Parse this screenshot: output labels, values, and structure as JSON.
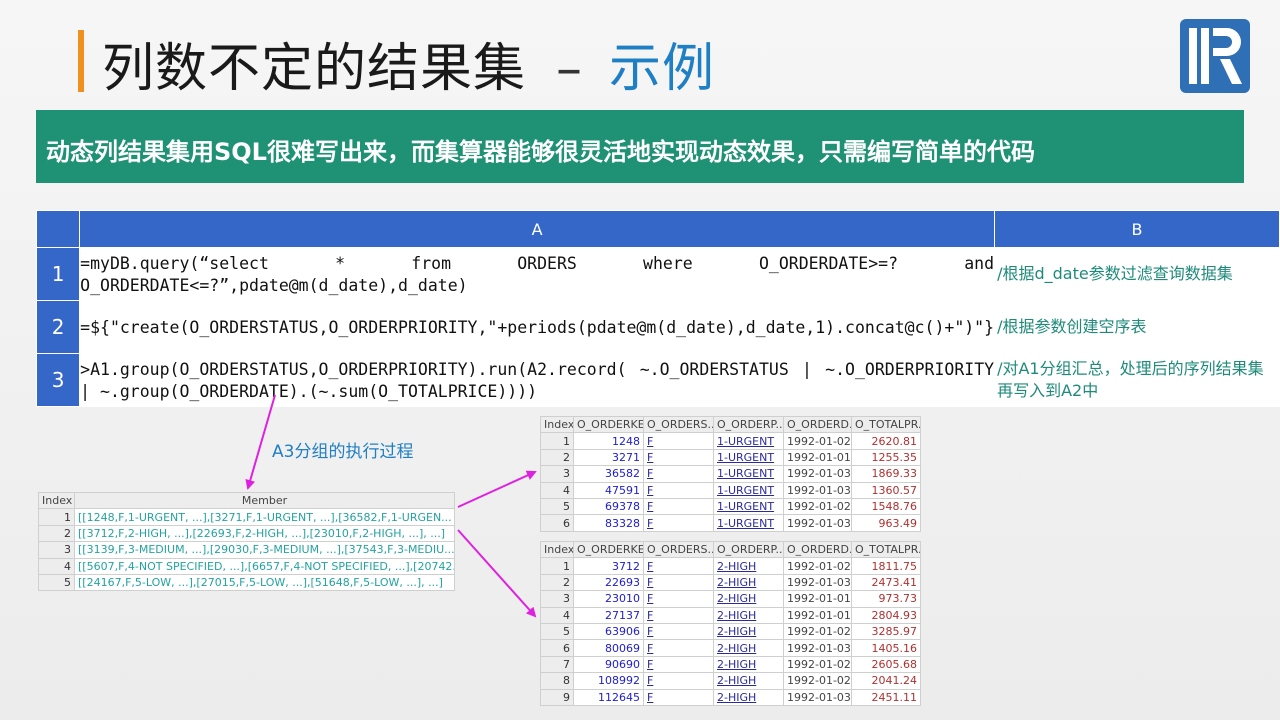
{
  "title": {
    "main": "列数不定的结果集",
    "sep": "–",
    "accent": "示例"
  },
  "banner": "动态列结果集用SQL很难写出来，而集算器能够很灵活地实现动态效果，只需编写简单的代码",
  "grid": {
    "headers": [
      "A",
      "B"
    ],
    "rows": [
      {
        "num": "1",
        "code": "=myDB.query(“select * from ORDERS where O_ORDERDATE>=? and O_ORDERDATE<=?”,pdate@m(d_date),d_date)",
        "comment": "/根据d_date参数过滤查询数据集"
      },
      {
        "num": "2",
        "code": "=${\"create(O_ORDERSTATUS,O_ORDERPRIORITY,\"+periods(pdate@m(d_date),d_date,1).concat@c()+\")\"}",
        "comment": "/根据参数创建空序表"
      },
      {
        "num": "3",
        "code": ">A1.group(O_ORDERSTATUS,O_ORDERPRIORITY).run(A2.record( ~.O_ORDERSTATUS | ~.O_ORDERPRIORITY | ~.group(O_ORDERDATE).(~.sum(O_TOTALPRICE))))",
        "comment": "/对A1分组汇总，处理后的序列结果集再写入到A2中"
      }
    ]
  },
  "a3_label": "A3分组的执行过程",
  "member_table": {
    "headers": [
      "Index",
      "Member"
    ],
    "rows": [
      [
        "1",
        "[[1248,F,1-URGENT, ...],[3271,F,1-URGENT, ...],[36582,F,1-URGEN..."
      ],
      [
        "2",
        "[[3712,F,2-HIGH, ...],[22693,F,2-HIGH, ...],[23010,F,2-HIGH, ...], ...]"
      ],
      [
        "3",
        "[[3139,F,3-MEDIUM, ...],[29030,F,3-MEDIUM, ...],[37543,F,3-MEDIU..."
      ],
      [
        "4",
        "[[5607,F,4-NOT SPECIFIED, ...],[6657,F,4-NOT SPECIFIED, ...],[20742..."
      ],
      [
        "5",
        "[[24167,F,5-LOW, ...],[27015,F,5-LOW, ...],[51648,F,5-LOW, ...], ...]"
      ]
    ]
  },
  "group1": {
    "headers": [
      "Index",
      "O_ORDERKEY",
      "O_ORDERS...",
      "O_ORDERP...",
      "O_ORDERD...",
      "O_TOTALPR..."
    ],
    "rows": [
      [
        "1",
        "1248",
        "F",
        "1-URGENT",
        "1992-01-02",
        "2620.81"
      ],
      [
        "2",
        "3271",
        "F",
        "1-URGENT",
        "1992-01-01",
        "1255.35"
      ],
      [
        "3",
        "36582",
        "F",
        "1-URGENT",
        "1992-01-03",
        "1869.33"
      ],
      [
        "4",
        "47591",
        "F",
        "1-URGENT",
        "1992-01-03",
        "1360.57"
      ],
      [
        "5",
        "69378",
        "F",
        "1-URGENT",
        "1992-01-02",
        "1548.76"
      ],
      [
        "6",
        "83328",
        "F",
        "1-URGENT",
        "1992-01-03",
        "963.49"
      ]
    ]
  },
  "group2": {
    "headers": [
      "Index",
      "O_ORDERKEY",
      "O_ORDERS...",
      "O_ORDERP...",
      "O_ORDERD...",
      "O_TOTALPR..."
    ],
    "rows": [
      [
        "1",
        "3712",
        "F",
        "2-HIGH",
        "1992-01-02",
        "1811.75"
      ],
      [
        "2",
        "22693",
        "F",
        "2-HIGH",
        "1992-01-03",
        "2473.41"
      ],
      [
        "3",
        "23010",
        "F",
        "2-HIGH",
        "1992-01-01",
        "973.73"
      ],
      [
        "4",
        "27137",
        "F",
        "2-HIGH",
        "1992-01-01",
        "2804.93"
      ],
      [
        "5",
        "63906",
        "F",
        "2-HIGH",
        "1992-01-02",
        "3285.97"
      ],
      [
        "6",
        "80069",
        "F",
        "2-HIGH",
        "1992-01-03",
        "1405.16"
      ],
      [
        "7",
        "90690",
        "F",
        "2-HIGH",
        "1992-01-02",
        "2605.68"
      ],
      [
        "8",
        "108992",
        "F",
        "2-HIGH",
        "1992-01-02",
        "2041.24"
      ],
      [
        "9",
        "112645",
        "F",
        "2-HIGH",
        "1992-01-03",
        "2451.11"
      ]
    ]
  },
  "colors": {
    "accent": "#1f7fc4",
    "title_bar": "#f0901e",
    "banner_bg": "#1f9175",
    "grid_header": "#3567c8",
    "comment": "#1e8b7a",
    "arrow": "#e020e0"
  }
}
